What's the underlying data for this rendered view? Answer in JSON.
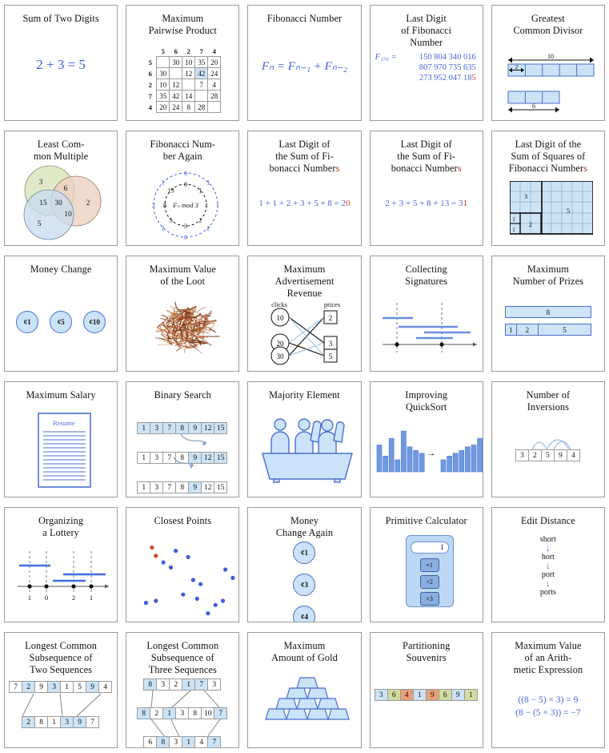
{
  "page": {
    "title": "Algorithmic Problems Grid",
    "accent_blue": "#3f5ad9",
    "accent_red": "#c0392b",
    "fill_light_blue": "#cbe3f5",
    "border_gray": "#9a9a9a"
  },
  "cells": [
    {
      "id": "sum-of-two-digits",
      "title": [
        "Sum of Two Digits"
      ],
      "art": "equation",
      "equation": "2 + 3 = 5"
    },
    {
      "id": "maximum-pairwise-product",
      "title": [
        "Maximum",
        "Pairwise Product"
      ],
      "art": "matrix",
      "matrix": {
        "headers": [
          "5",
          "6",
          "2",
          "7",
          "4"
        ],
        "rows": [
          {
            "label": "5",
            "values": [
              "",
              "30",
              "10",
              "35",
              "20"
            ]
          },
          {
            "label": "6",
            "values": [
              "30",
              "",
              "12",
              "42",
              "24"
            ]
          },
          {
            "label": "2",
            "values": [
              "10",
              "12",
              "",
              "7",
              "4"
            ]
          },
          {
            "label": "7",
            "values": [
              "35",
              "42",
              "14",
              "",
              "28"
            ]
          },
          {
            "label": "4",
            "values": [
              "20",
              "24",
              "8",
              "28",
              ""
            ]
          }
        ],
        "highlight": {
          "row": 1,
          "col": 3
        }
      }
    },
    {
      "id": "fibonacci-number",
      "title": [
        "Fibonacci Number"
      ],
      "art": "formula",
      "formula": "Fₙ = Fₙ₋₁ + Fₙ₋₂"
    },
    {
      "id": "last-digit-of-fibonacci-number",
      "title": [
        "Last Digit",
        "of Fibonacci",
        "Number"
      ],
      "art": "bignumber",
      "bignumber": {
        "prefix": "F₁₇₀ =",
        "lines": [
          "150 804 340 016",
          "807 970 735 635",
          "273 952 047 18"
        ],
        "last_digit": "5"
      }
    },
    {
      "id": "greatest-common-divisor",
      "title": [
        "Greatest",
        "Common Divisor"
      ],
      "art": "gcd-bars",
      "gcd": {
        "top_label": "10",
        "segment_label": "2",
        "bottom_label": "6",
        "top_segments": 5,
        "bottom_segments": 3
      }
    },
    {
      "id": "least-common-multiple",
      "title": [
        "Least Com-",
        "mon Multiple"
      ],
      "art": "venn",
      "venn": {
        "a": "3",
        "b": "2",
        "c": "5",
        "ab": "6",
        "ac": "15",
        "bc": "10",
        "abc": "30"
      }
    },
    {
      "id": "fibonacci-number-again",
      "title": [
        "Fibonacci Num-",
        "ber Again"
      ],
      "art": "fib-circle",
      "fib_circle": {
        "center": "Fₙ mod 3",
        "inner": [
          "0",
          "1",
          "1",
          "2",
          "3",
          "5",
          "8",
          "13"
        ],
        "outer": [
          "0",
          "1",
          "1",
          "2",
          "0",
          "2",
          "2",
          "1"
        ]
      }
    },
    {
      "id": "last-digit-sum-fibonacci-1",
      "title": [
        "Last Digit of",
        "the Sum of Fi-",
        "bonacci Number"
      ],
      "title_red_suffix": "s",
      "art": "sum-equation",
      "sum_equation": {
        "text": "1 + 1 + 2 + 3 + 5 + 8 = 2",
        "last_digit": "0"
      }
    },
    {
      "id": "last-digit-sum-fibonacci-2",
      "title": [
        "Last Digit of",
        "the Sum of Fi-",
        "bonacci Number"
      ],
      "title_red_suffix": "s",
      "art": "sum-equation",
      "sum_equation": {
        "text": "2 + 3 + 5 + 8 + 13 = 3",
        "last_digit": "1"
      }
    },
    {
      "id": "last-digit-sum-squares-fibonacci",
      "title": [
        "Last Digit of the",
        "Sum of Squares of",
        "Fibonacci Number"
      ],
      "title_red_suffix": "s",
      "art": "squares-tiling",
      "squares": {
        "labels": [
          "1",
          "1",
          "2",
          "3",
          "5"
        ]
      }
    },
    {
      "id": "money-change",
      "title": [
        "Money Change"
      ],
      "art": "coins-row",
      "coins": [
        "¢1",
        "¢5",
        "¢10"
      ]
    },
    {
      "id": "maximum-value-of-the-loot",
      "title": [
        "Maximum Value",
        "of the Loot"
      ],
      "art": "loot"
    },
    {
      "id": "maximum-advertisement-revenue",
      "title": [
        "Maximum",
        "Advertisement",
        "Revenue"
      ],
      "art": "bipartite",
      "bipartite": {
        "left_label": "clicks",
        "right_label": "prices",
        "left": [
          "10",
          "20",
          "30"
        ],
        "right": [
          "2",
          "3",
          "5"
        ]
      }
    },
    {
      "id": "collecting-signatures",
      "title": [
        "Collecting",
        "Signatures"
      ],
      "art": "segments"
    },
    {
      "id": "maximum-number-of-prizes",
      "title": [
        "Maximum",
        "Number of Prizes"
      ],
      "art": "prizes",
      "prizes": {
        "total": "8",
        "parts": [
          "1",
          "2",
          "5"
        ]
      }
    },
    {
      "id": "maximum-salary",
      "title": [
        "Maximum Salary"
      ],
      "art": "resume",
      "resume_label": "Resume"
    },
    {
      "id": "binary-search",
      "title": [
        "Binary Search"
      ],
      "art": "binary-search",
      "binary_search": {
        "values": [
          "1",
          "3",
          "7",
          "8",
          "9",
          "12",
          "15"
        ],
        "rows": [
          {
            "highlight": [
              0,
              1,
              2,
              3,
              4,
              5,
              6
            ]
          },
          {
            "highlight": [
              4,
              5,
              6
            ]
          },
          {
            "highlight": [
              4
            ]
          }
        ]
      }
    },
    {
      "id": "majority-element",
      "title": [
        "Majority Element"
      ],
      "art": "majority"
    },
    {
      "id": "improving-quicksort",
      "title": [
        "Improving",
        "QuickSort"
      ],
      "art": "quicksort",
      "quicksort": {
        "unsorted": [
          58,
          34,
          72,
          26,
          88,
          54,
          46,
          40
        ],
        "sorted": [
          26,
          34,
          40,
          46,
          54,
          58,
          72,
          88
        ],
        "arrow": "→"
      }
    },
    {
      "id": "number-of-inversions",
      "title": [
        "Number of",
        "Inversions"
      ],
      "art": "inversions",
      "inversions": {
        "values": [
          "3",
          "2",
          "5",
          "9",
          "4"
        ],
        "arcs": [
          [
            0,
            1
          ],
          [
            2,
            4
          ],
          [
            3,
            4
          ]
        ]
      }
    },
    {
      "id": "organizing-a-lottery",
      "title": [
        "Organizing",
        "a Lottery"
      ],
      "art": "lottery",
      "lottery": {
        "counts": [
          "1",
          "0",
          "2",
          "1"
        ]
      }
    },
    {
      "id": "closest-points",
      "title": [
        "Closest Points"
      ],
      "art": "points",
      "points": {
        "blue": [
          [
            55,
            58
          ],
          [
            80,
            30
          ],
          [
            105,
            45
          ],
          [
            115,
            100
          ],
          [
            70,
            70
          ],
          [
            95,
            135
          ],
          [
            130,
            110
          ],
          [
            123,
            145
          ],
          [
            20,
            155
          ],
          [
            40,
            150
          ],
          [
            160,
            160
          ],
          [
            175,
            150
          ],
          [
            145,
            180
          ],
          [
            180,
            75
          ],
          [
            195,
            95
          ]
        ],
        "red": [
          [
            32,
            22
          ],
          [
            40,
            42
          ]
        ]
      }
    },
    {
      "id": "money-change-again",
      "title": [
        "Money",
        "Change Again"
      ],
      "art": "coins-col",
      "coins": [
        "¢1",
        "¢3",
        "¢4"
      ]
    },
    {
      "id": "primitive-calculator",
      "title": [
        "Primitive Calculator"
      ],
      "art": "calculator",
      "calculator": {
        "display": "1",
        "buttons": [
          "+1",
          "×2",
          "×3"
        ]
      }
    },
    {
      "id": "edit-distance",
      "title": [
        "Edit Distance"
      ],
      "art": "edit-distance",
      "edit_distance": {
        "steps": [
          "short",
          "hort",
          "port",
          "ports"
        ]
      }
    },
    {
      "id": "lcs-two-sequences",
      "title": [
        "Longest Common",
        "Subsequence of",
        "Two Sequences"
      ],
      "art": "lcs2",
      "lcs2": {
        "top": [
          "7",
          "2",
          "9",
          "3",
          "1",
          "5",
          "9",
          "4"
        ],
        "top_highlight": [
          1,
          3,
          6
        ],
        "bottom": [
          "2",
          "8",
          "1",
          "3",
          "9",
          "7"
        ],
        "bottom_highlight": [
          0,
          3,
          4
        ]
      }
    },
    {
      "id": "lcs-three-sequences",
      "title": [
        "Longest Common",
        "Subsequence of",
        "Three Sequences"
      ],
      "art": "lcs3",
      "lcs3": {
        "top": [
          "8",
          "3",
          "2",
          "1",
          "7",
          "3"
        ],
        "top_highlight": [
          0,
          3,
          4
        ],
        "mid": [
          "8",
          "2",
          "1",
          "3",
          "8",
          "10",
          "7"
        ],
        "mid_highlight": [
          0,
          2,
          6
        ],
        "bottom": [
          "6",
          "8",
          "3",
          "1",
          "4",
          "7"
        ],
        "bottom_highlight": [
          1,
          3,
          5
        ]
      }
    },
    {
      "id": "maximum-amount-of-gold",
      "title": [
        "Maximum",
        "Amount of Gold"
      ],
      "art": "gold"
    },
    {
      "id": "partitioning-souvenirs",
      "title": [
        "Partitioning",
        "Souvenirs"
      ],
      "art": "souvenirs",
      "souvenirs": {
        "values": [
          "3",
          "6",
          "4",
          "1",
          "9",
          "6",
          "9",
          "1"
        ],
        "colors": [
          "#cbe3f5",
          "#cfdba0",
          "#e8a07a",
          "#cbe3f5",
          "#e8a07a",
          "#cfdba0",
          "#cbe3f5",
          "#cfdba0"
        ]
      }
    },
    {
      "id": "maximum-value-arithmetic-expression",
      "title": [
        "Maximum Value",
        "of an Arith-",
        "metic Expression"
      ],
      "art": "expressions",
      "expressions": [
        "((8 − 5) × 3) = 9",
        "(8 − (5 × 3)) = −7"
      ]
    }
  ]
}
